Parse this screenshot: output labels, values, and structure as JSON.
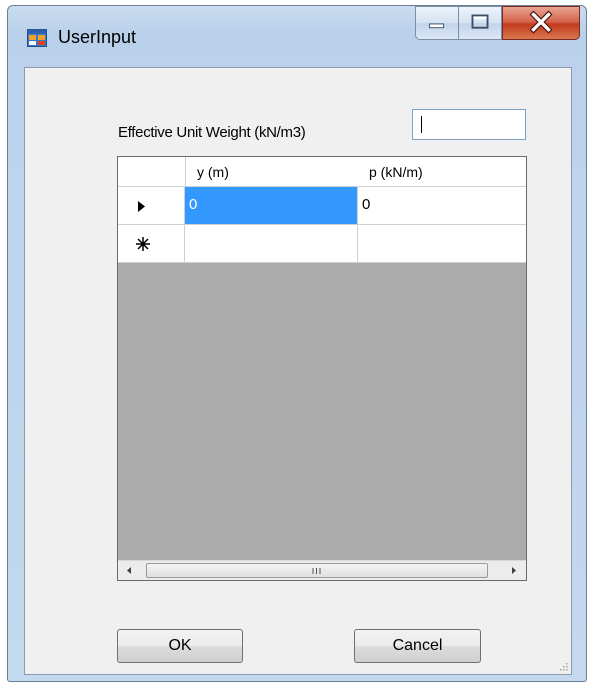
{
  "window": {
    "title": "UserInput",
    "app_icon": "form-app-icon",
    "controls": {
      "minimize_icon": "minimize-icon",
      "maximize_icon": "maximize-icon",
      "close_icon": "close-icon",
      "close_color": "#c43b1f"
    }
  },
  "form": {
    "unit_weight_label": "Effective Unit Weight (kN/m3)",
    "unit_weight_value": ""
  },
  "grid": {
    "columns": [
      "y (m)",
      "p (kN/m)"
    ],
    "rows": [
      {
        "indicator": "current-row-arrow-icon",
        "cells": [
          "0",
          "0"
        ],
        "selected_column": 0
      },
      {
        "indicator": "new-row-asterisk-icon",
        "cells": [
          "",
          ""
        ]
      }
    ],
    "selection_color": "#3399ff",
    "background_color": "#ababab",
    "scrollbar": {
      "grip_icon": "scroll-grip-icon"
    }
  },
  "buttons": {
    "ok_label": "OK",
    "cancel_label": "Cancel"
  }
}
